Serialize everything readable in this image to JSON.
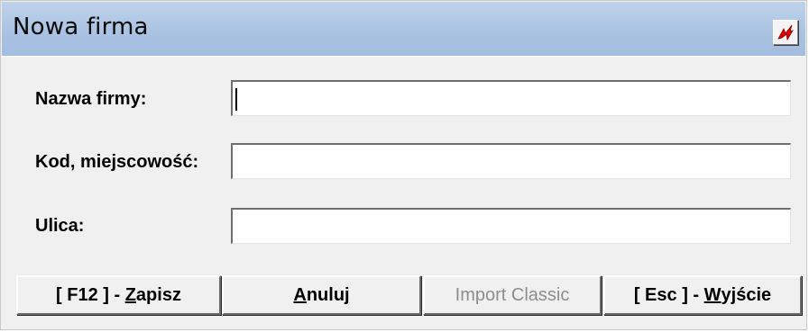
{
  "window": {
    "title": "Nowa firma",
    "close_icon": "close-lightning-icon"
  },
  "form": {
    "company_name": {
      "label": "Nazwa firmy:",
      "value": ""
    },
    "postal_city": {
      "label": "Kod, miejscowość:",
      "value": ""
    },
    "street": {
      "label": "Ulica:",
      "value": ""
    }
  },
  "buttons": {
    "save": {
      "prefix": "[ F12 ] - ",
      "mnemonic": "Z",
      "rest": "apisz"
    },
    "cancel": {
      "mnemonic": "A",
      "rest": "nuluj"
    },
    "import": {
      "label": "Import Classic",
      "disabled": true
    },
    "exit": {
      "prefix": "[ Esc ] - ",
      "mnemonic": "W",
      "rest": "yjście"
    }
  },
  "colors": {
    "titlebar": "#a9c2e2",
    "window_bg": "#f0f0f0",
    "close_glyph": "#e00000",
    "disabled_text": "#8d8d8d"
  }
}
